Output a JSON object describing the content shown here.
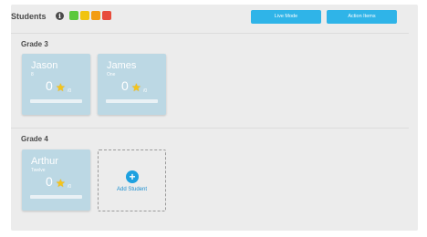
{
  "header": {
    "title": "Students",
    "info_icon": "info-icon",
    "swatches": [
      "#5cc83c",
      "#f1c40f",
      "#f39c12",
      "#e74c3c"
    ],
    "live_mode_label": "Live Mode",
    "action_items_label": "Action Items"
  },
  "groups": [
    {
      "title": "Grade 3",
      "students": [
        {
          "name": "Jason",
          "sub": "8",
          "score": "0",
          "denom": "/0",
          "star_icon": "star-icon"
        },
        {
          "name": "James",
          "sub": "One",
          "score": "0",
          "denom": "/0",
          "star_icon": "star-icon"
        }
      ]
    },
    {
      "title": "Grade 4",
      "students": [
        {
          "name": "Arthur",
          "sub": "Twelve",
          "score": "0",
          "denom": "/0",
          "star_icon": "star-icon"
        }
      ],
      "add_label": "Add Student"
    }
  ],
  "colors": {
    "accent": "#2fb4e8",
    "card_bg": "#bcd8e4",
    "panel_bg": "#ececec"
  }
}
